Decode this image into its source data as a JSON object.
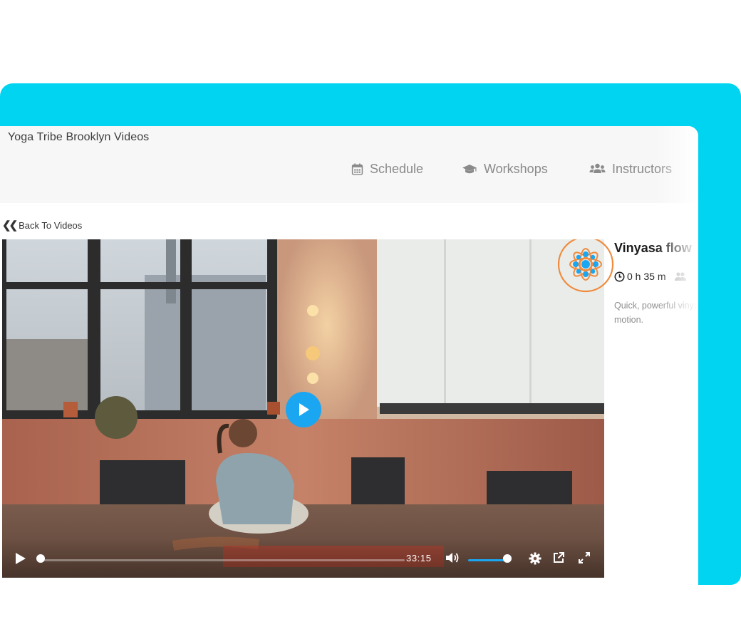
{
  "site": {
    "title": "Yoga Tribe Brooklyn Videos"
  },
  "nav": {
    "items": [
      {
        "label": "Schedule",
        "icon": "calendar-icon"
      },
      {
        "label": "Workshops",
        "icon": "graduation-cap-icon"
      },
      {
        "label": "Instructors",
        "icon": "users-icon"
      }
    ]
  },
  "back_link": {
    "label": "Back To Videos",
    "icon": "double-chevron-left-icon"
  },
  "video": {
    "current_time": "33:15",
    "progress": 0.0,
    "volume": 1.0
  },
  "details": {
    "title": "Vinyasa flow",
    "duration": "0 h 35 m",
    "description": "Quick, powerful vinyasa for range of motion."
  },
  "colors": {
    "accent_cyan": "#00d4f0",
    "play_blue": "#1ba6f2",
    "logo_orange": "#f08a3c"
  }
}
